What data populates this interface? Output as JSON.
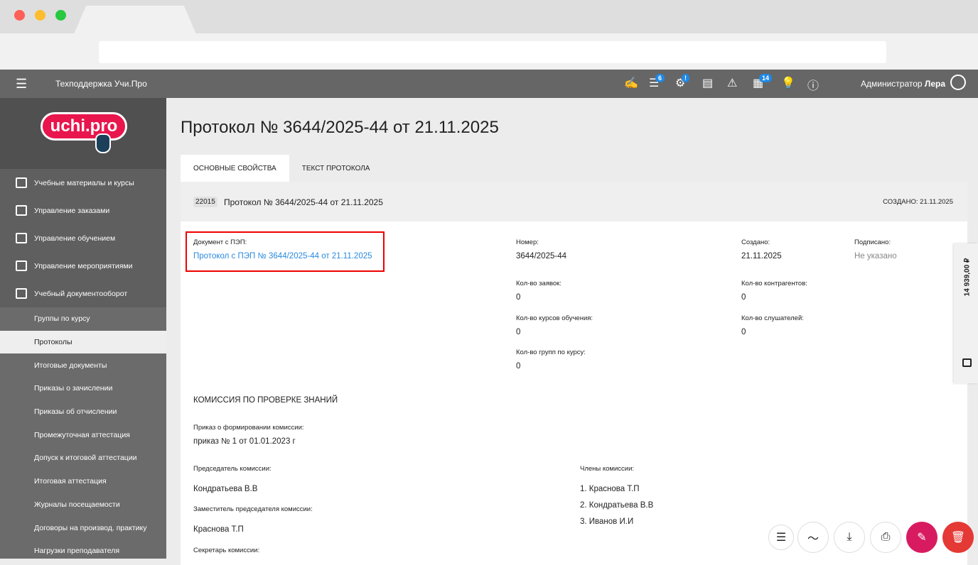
{
  "header": {
    "title": "Техподдержка Учи.Про",
    "badges": {
      "tasks": "6",
      "plugins": "!",
      "docs": "14"
    },
    "user_role": "Администратор",
    "user_name": "Лера"
  },
  "logo": "uchi.pro",
  "sidebar": {
    "main": [
      "Учебные материалы и курсы",
      "Управление заказами",
      "Управление обучением",
      "Управление мероприятиями",
      "Учебный документооборот"
    ],
    "sub": [
      "Группы по курсу",
      "Протоколы",
      "Итоговые документы",
      "Приказы о зачислении",
      "Приказы об отчислении",
      "Промежуточная аттестация",
      "Допуск к итоговой аттестации",
      "Итоговая аттестация",
      "Журналы посещаемости",
      "Договоры на производ. практику",
      "Нагрузки преподавателя"
    ]
  },
  "page": {
    "title": "Протокол № 3644/2025-44 от 21.11.2025",
    "tabs": [
      "ОСНОВНЫЕ СВОЙСТВА",
      "ТЕКСТ ПРОТОКОЛА"
    ],
    "card": {
      "id": "22015",
      "title": "Протокол № 3644/2025-44 от 21.11.2025",
      "created_label": "СОЗДАНО:",
      "created": "21.11.2025"
    },
    "fields": {
      "doc_label": "Документ с ПЭП:",
      "doc_link": "Протокол с ПЭП № 3644/2025-44 от 21.11.2025",
      "number_label": "Номер:",
      "number": "3644/2025-44",
      "created_label": "Создано:",
      "created": "21.11.2025",
      "signed_label": "Подписано:",
      "signed": "Не указано",
      "orders_label": "Кол-во заявок:",
      "orders": "0",
      "contractors_label": "Кол-во контрагентов:",
      "contractors": "0",
      "courses_label": "Кол-во курсов обучения:",
      "courses": "0",
      "listeners_label": "Кол-во слушателей:",
      "listeners": "0",
      "groups_label": "Кол-во групп по курсу:",
      "groups": "0"
    },
    "commission": {
      "title": "КОМИССИЯ ПО ПРОВЕРКЕ ЗНАНИЙ",
      "order_label": "Приказ о формировании комиссии:",
      "order": "приказ № 1 от 01.01.2023 г",
      "chair_label": "Председатель комиссии:",
      "chair": "Кондратьева В.В",
      "deputy_label": "Заместитель председателя комиссии:",
      "deputy": "Краснова Т.П",
      "secretary_label": "Секретарь комиссии:",
      "members_label": "Члены комиссии:",
      "members": [
        "1. Краснова Т.П",
        "2. Кондратьева В.В",
        "3. Иванов И.И"
      ]
    }
  },
  "balance": "14 939,00 ₽"
}
